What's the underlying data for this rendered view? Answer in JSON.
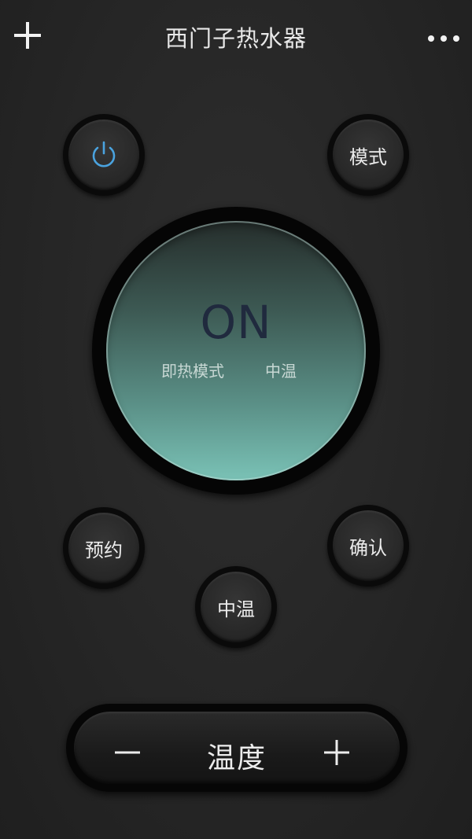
{
  "header": {
    "title": "西门子热水器",
    "add_icon": "plus-icon",
    "more_icon": "more-dots-icon"
  },
  "buttons": {
    "power_icon": "power-icon",
    "mode_label": "模式",
    "schedule_label": "预约",
    "confirm_label": "确认",
    "temp_level_label": "中温"
  },
  "display": {
    "state": "ON",
    "mode": "即热模式",
    "temperature": "中温"
  },
  "temperature_control": {
    "label": "温度",
    "minus_icon": "minus-icon",
    "plus_icon": "plus-icon"
  },
  "colors": {
    "background": "#262626",
    "power_accent": "#4aa3df",
    "display_top": "#262e2c",
    "display_bottom": "#7ac2b6",
    "display_state_text": "#202a3e"
  }
}
